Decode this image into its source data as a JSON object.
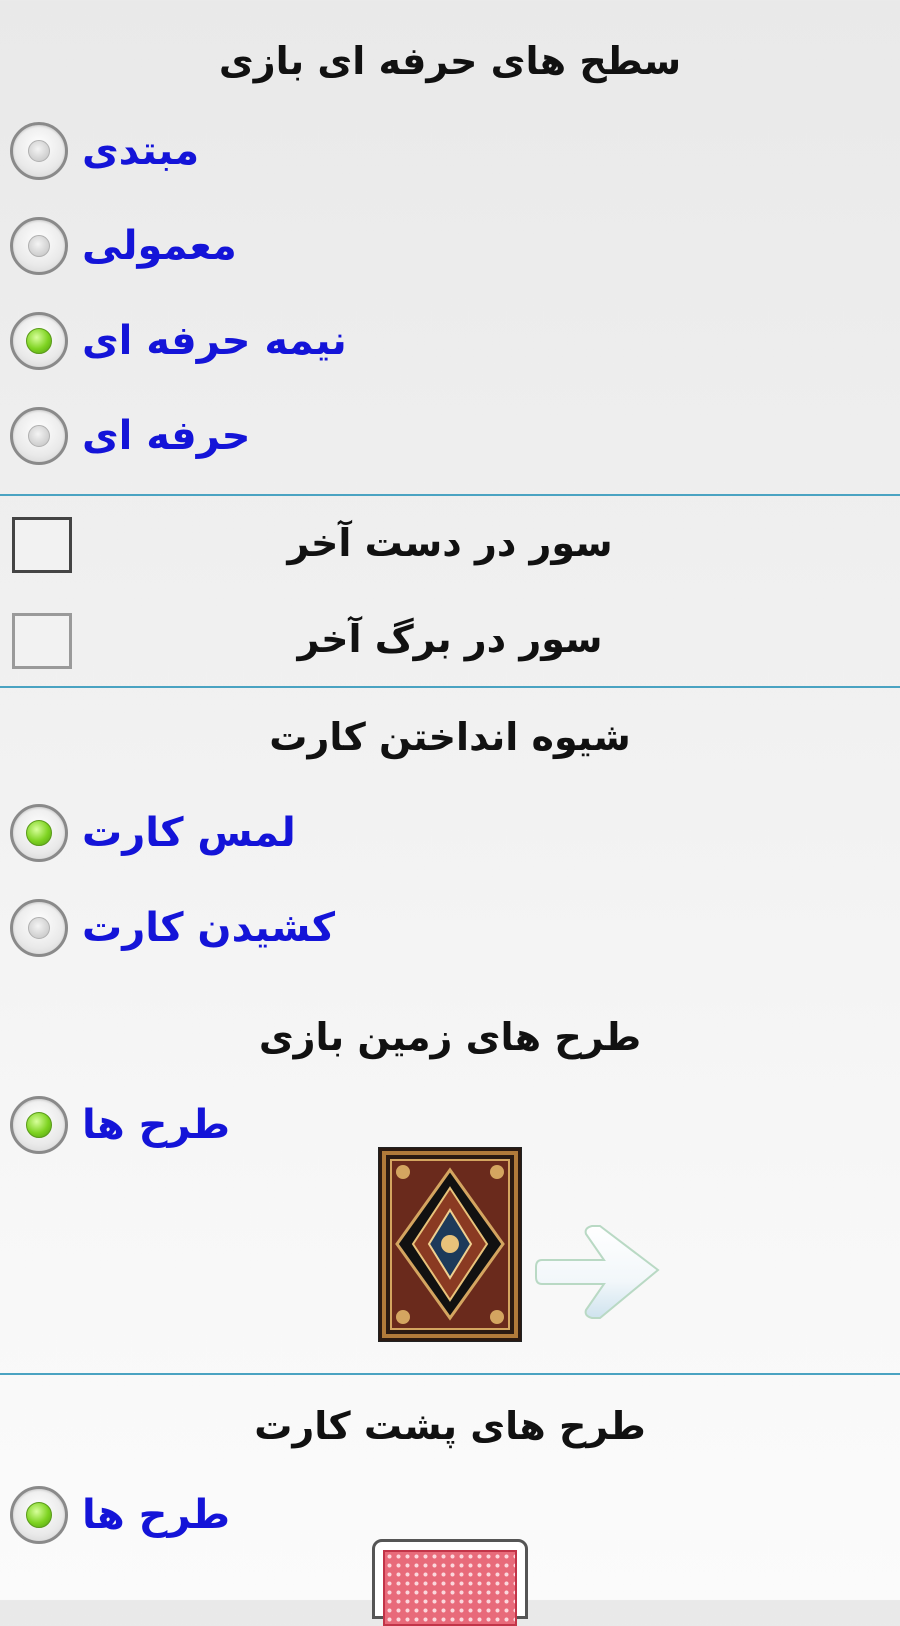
{
  "sections": {
    "levels": {
      "title": "سطح های حرفه ای بازی",
      "options": [
        {
          "label": "مبتدی",
          "checked": false
        },
        {
          "label": "معمولی",
          "checked": false
        },
        {
          "label": "نیمه حرفه ای",
          "checked": true
        },
        {
          "label": "حرفه ای",
          "checked": false
        }
      ]
    },
    "sour": {
      "options": [
        {
          "label": "سور در دست آخر",
          "checked": false
        },
        {
          "label": "سور در برگ آخر",
          "checked": false
        }
      ]
    },
    "play_method": {
      "title": "شیوه انداختن کارت",
      "options": [
        {
          "label": "لمس کارت",
          "checked": true
        },
        {
          "label": "کشیدن کارت",
          "checked": false
        }
      ]
    },
    "table_design": {
      "title": "طرح های زمین بازی",
      "option": {
        "label": "طرح ها",
        "checked": true
      }
    },
    "card_back": {
      "title": "طرح های پشت کارت",
      "option": {
        "label": "طرح ها",
        "checked": true
      }
    }
  },
  "icons": {
    "next_arrow": "arrow-right-icon",
    "table_preview": "carpet-preview-image",
    "card_preview": "card-back-preview-image"
  },
  "colors": {
    "option_label": "#1414d8",
    "divider": "#4aa3c2",
    "radio_checked": "#7ed321"
  }
}
